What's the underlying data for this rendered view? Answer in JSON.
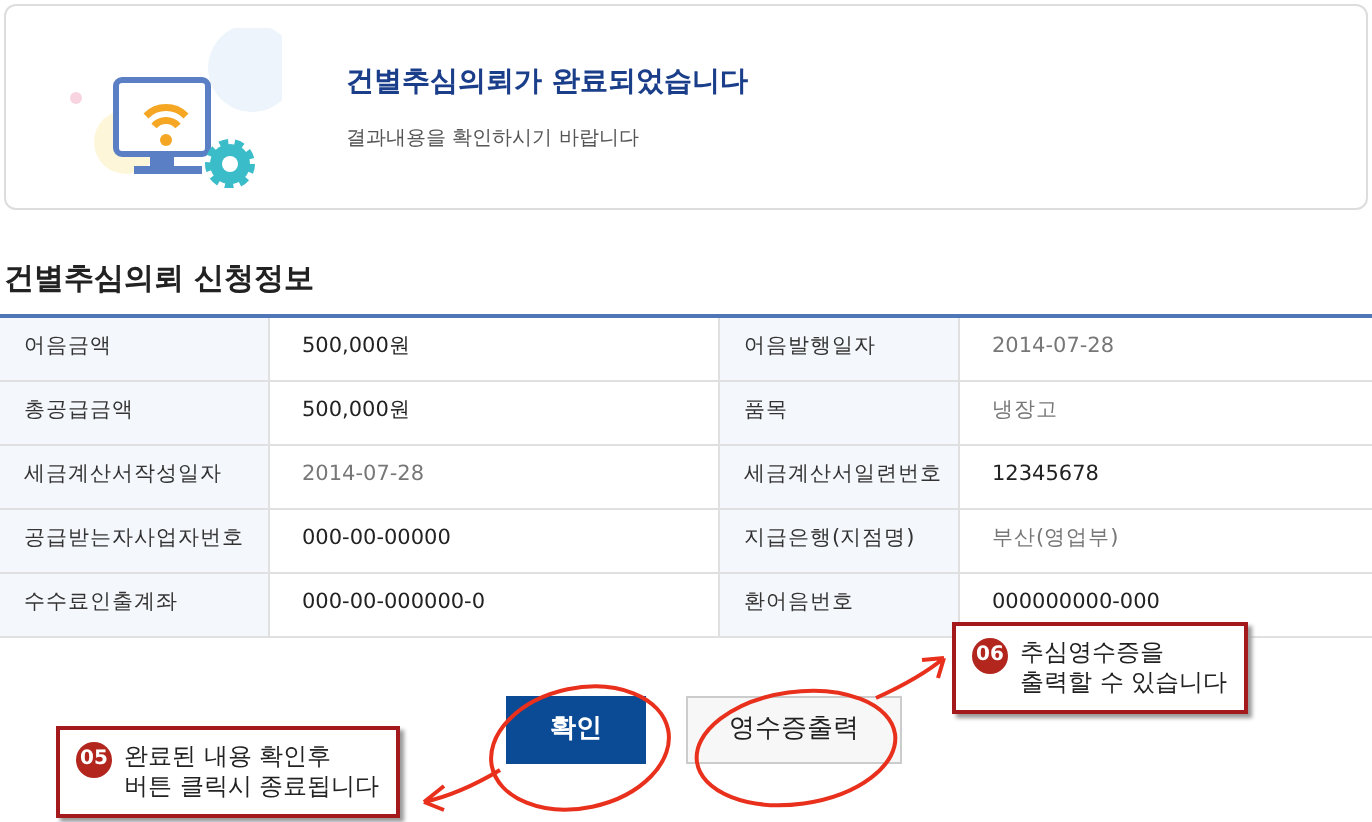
{
  "banner": {
    "title": "건별추심의뢰가 완료되었습니다",
    "subtitle": "결과내용을 확인하시기 바랍니다"
  },
  "section_title": "건별추심의뢰 신청정보",
  "table": {
    "rows": [
      {
        "cells": [
          {
            "label": "어음금액",
            "value": "500,000원",
            "muted": false
          },
          {
            "label": "어음발행일자",
            "value": "2014-07-28",
            "muted": true
          }
        ]
      },
      {
        "cells": [
          {
            "label": "총공급금액",
            "value": "500,000원",
            "muted": false
          },
          {
            "label": "품목",
            "value": "냉장고",
            "muted": true
          }
        ]
      },
      {
        "cells": [
          {
            "label": "세금계산서작성일자",
            "value": "2014-07-28",
            "muted": true
          },
          {
            "label": "세금계산서일련번호",
            "value": "12345678",
            "muted": false
          }
        ]
      },
      {
        "cells": [
          {
            "label": "공급받는자사업자번호",
            "value": "000-00-00000",
            "muted": false
          },
          {
            "label": "지급은행(지점명)",
            "value": "부산(영업부)",
            "muted": true
          }
        ]
      },
      {
        "cells": [
          {
            "label": "수수료인출계좌",
            "value": "000-00-000000-0",
            "muted": false
          },
          {
            "label": "환어음번호",
            "value": "000000000-000",
            "muted": false
          }
        ]
      }
    ]
  },
  "buttons": [
    {
      "label": "확인",
      "kind": "primary"
    },
    {
      "label": "영수증출력",
      "kind": "secondary"
    }
  ],
  "callouts": [
    {
      "number": "05",
      "lines": [
        "완료된 내용 확인후",
        "버튼 클릭시 종료됩니다"
      ]
    },
    {
      "number": "06",
      "lines": [
        "추심영수증을",
        "출력할 수 있습니다"
      ]
    }
  ]
}
